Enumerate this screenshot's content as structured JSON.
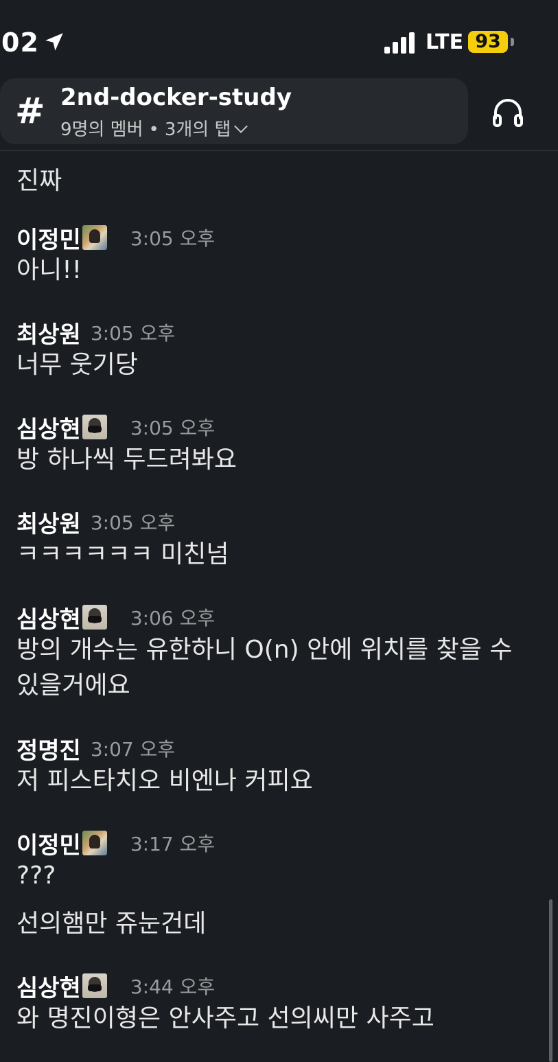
{
  "status_bar": {
    "time": "02",
    "network": "LTE",
    "battery": "93"
  },
  "channel": {
    "name": "2nd-docker-study",
    "members": "9명의 멤버",
    "tabs": "3개의 탭",
    "icons": [
      "hash-icon",
      "chevron-down-icon",
      "headphones-icon"
    ]
  },
  "messages": [
    {
      "text": "진짜"
    },
    {
      "sender": "이정민",
      "time": "3:05 오후",
      "text": "아니!!"
    },
    {
      "sender": "최상원",
      "time": "3:05 오후",
      "text": "너무 웃기당"
    },
    {
      "sender": "심상현",
      "time": "3:05 오후",
      "text": "방 하나씩 두드려봐요"
    },
    {
      "sender": "최상원",
      "time": "3:05 오후",
      "text": "ㅋㅋㅋㅋㅋㅋ 미친넘"
    },
    {
      "sender": "심상현",
      "time": "3:06 오후",
      "text": "방의 개수는 유한하니 O(n) 안에 위치를 찾을 수 있을거에요"
    },
    {
      "sender": "정명진",
      "time": "3:07 오후",
      "text": "저 피스타치오 비엔나 커피요"
    },
    {
      "sender": "이정민",
      "time": "3:17 오후",
      "text": "???",
      "text2": "선의햄만 쥬눈건데"
    },
    {
      "sender": "심상현",
      "time": "3:44 오후",
      "text": "와 명진이형은 안사주고 선의씨만 사주고"
    }
  ]
}
